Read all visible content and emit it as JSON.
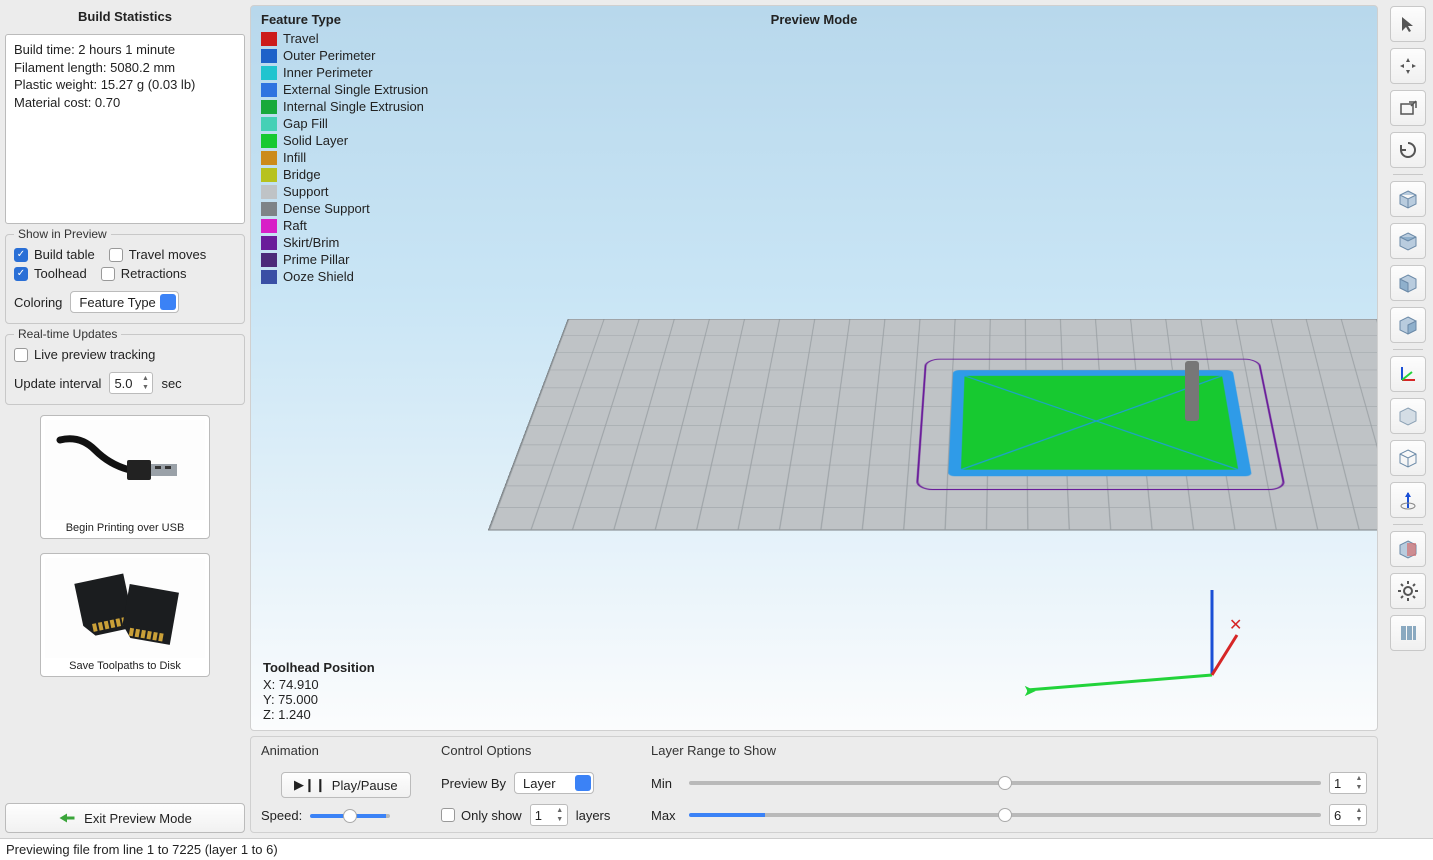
{
  "sidebar": {
    "title": "Build Statistics",
    "stats": {
      "build_time": "Build time: 2 hours 1 minute",
      "filament": "Filament length: 5080.2 mm",
      "weight": "Plastic weight: 15.27 g (0.03 lb)",
      "cost": "Material cost: 0.70"
    },
    "preview_group": {
      "label": "Show in Preview",
      "build_table": "Build table",
      "travel_moves": "Travel moves",
      "toolhead": "Toolhead",
      "retractions": "Retractions",
      "coloring_label": "Coloring",
      "coloring_value": "Feature Type"
    },
    "realtime_group": {
      "label": "Real-time Updates",
      "live_preview": "Live preview tracking",
      "interval_label": "Update interval",
      "interval_value": "5.0",
      "interval_unit": "sec"
    },
    "usb_caption": "Begin Printing over USB",
    "disk_caption": "Save Toolpaths to Disk",
    "exit": "Exit Preview Mode"
  },
  "viewport": {
    "legend_title": "Feature Type",
    "legend": [
      {
        "color": "#cc1b1b",
        "label": "Travel"
      },
      {
        "color": "#1e62c9",
        "label": "Outer Perimeter"
      },
      {
        "color": "#20c4cf",
        "label": "Inner Perimeter"
      },
      {
        "color": "#2f73e0",
        "label": "External Single Extrusion"
      },
      {
        "color": "#17a93b",
        "label": "Internal Single Extrusion"
      },
      {
        "color": "#45d0b6",
        "label": "Gap Fill"
      },
      {
        "color": "#17c930",
        "label": "Solid Layer"
      },
      {
        "color": "#cc8b1b",
        "label": "Infill"
      },
      {
        "color": "#b7c21e",
        "label": "Bridge"
      },
      {
        "color": "#bfc3c6",
        "label": "Support"
      },
      {
        "color": "#7e8387",
        "label": "Dense Support"
      },
      {
        "color": "#d81fc7",
        "label": "Raft"
      },
      {
        "color": "#6a1c9a",
        "label": "Skirt/Brim"
      },
      {
        "color": "#4c2a7a",
        "label": "Prime Pillar"
      },
      {
        "color": "#3a4fa5",
        "label": "Ooze Shield"
      }
    ],
    "mode": "Preview Mode",
    "toolhead_title": "Toolhead Position",
    "x": "X: 74.910",
    "y": "Y: 75.000",
    "z": "Z: 1.240"
  },
  "bottom": {
    "animation": {
      "title": "Animation",
      "play": "Play/Pause",
      "speed": "Speed:"
    },
    "control": {
      "title": "Control Options",
      "preview_by": "Preview By",
      "preview_by_val": "Layer",
      "only_show": "Only show",
      "only_show_val": "1",
      "layers": "layers"
    },
    "range": {
      "title": "Layer Range to Show",
      "min": "Min",
      "min_val": "1",
      "max": "Max",
      "max_val": "6"
    }
  },
  "statusbar": "Previewing file from line 1 to 7225 (layer 1 to 6)"
}
